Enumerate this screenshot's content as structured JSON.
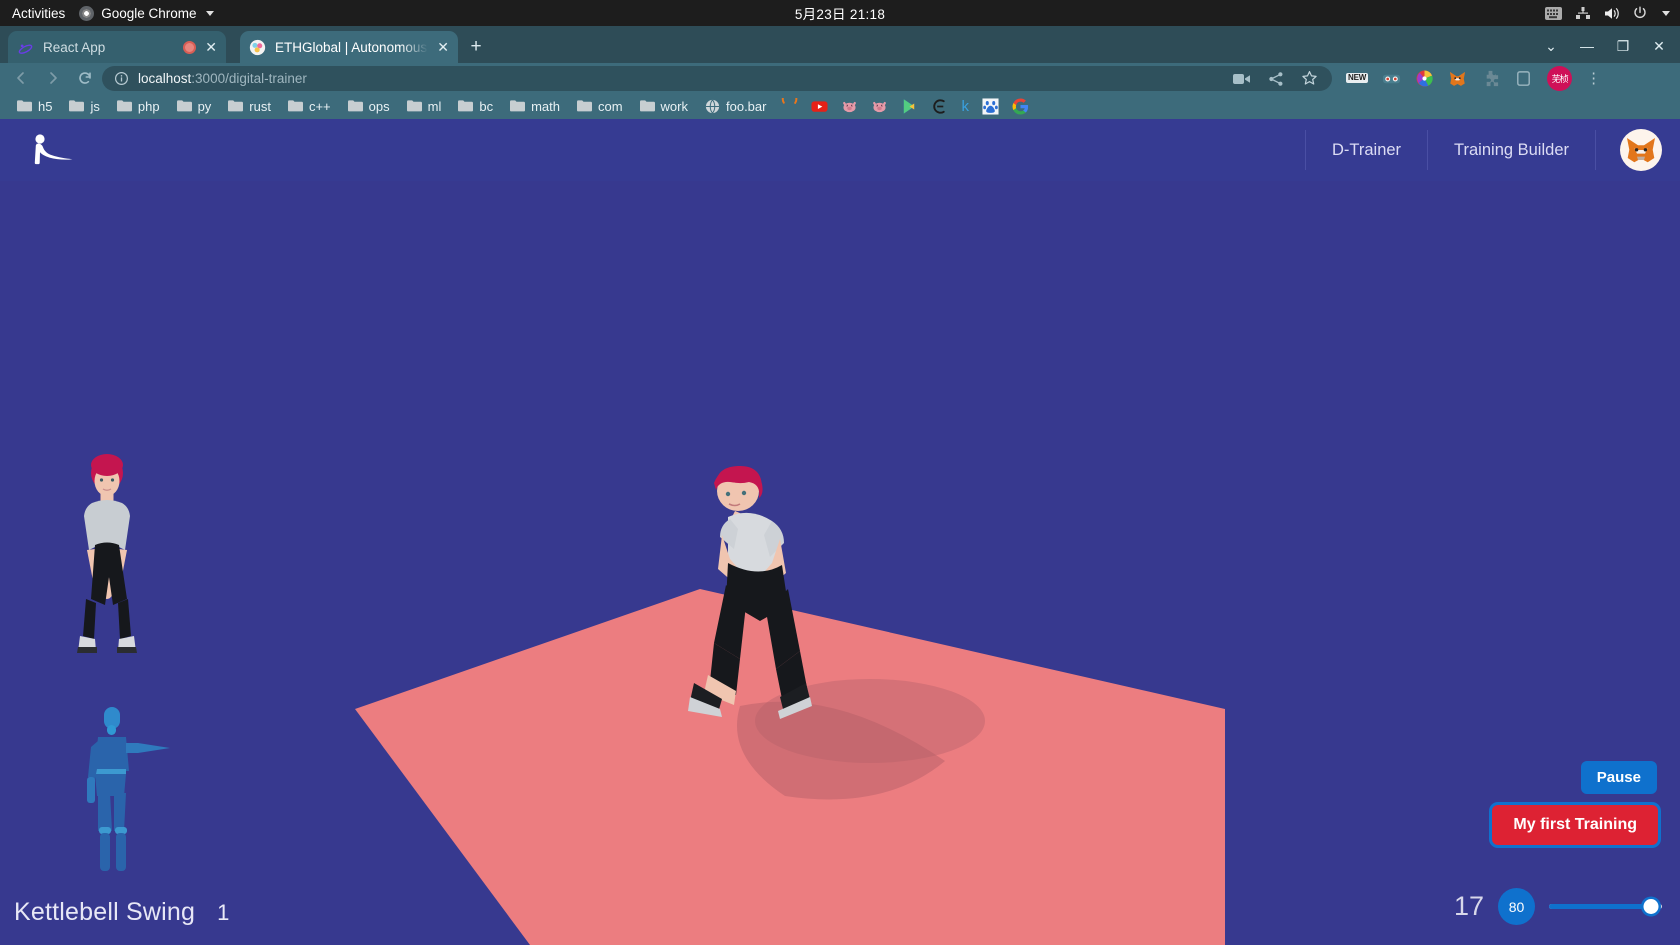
{
  "desktop": {
    "activities_label": "Activities",
    "active_app": "Google Chrome",
    "clock": "5月23日  21:18",
    "tray_icons": [
      "keyboard-icon",
      "network-icon",
      "volume-icon",
      "power-icon",
      "chevron-down-icon"
    ]
  },
  "browser": {
    "tabs": [
      {
        "title": "React App",
        "favicon": "react-icon",
        "recording": true,
        "active": false
      },
      {
        "title": "ETHGlobal | Autonomous",
        "favicon": "ethglobal-icon",
        "recording": false,
        "active": true
      }
    ],
    "new_tab_label": "+",
    "window_controls": [
      "tab-search-chevron",
      "minimize",
      "maximize",
      "close"
    ],
    "nav": {
      "back": "back-icon",
      "forward": "forward-icon",
      "reload": "reload-icon"
    },
    "omnibox": {
      "site_info_icon": "info-circle-icon",
      "url_host": "localhost",
      "url_path": ":3000/digital-trainer",
      "actions": [
        "media-cast-icon",
        "share-icon",
        "bookmark-star-icon"
      ]
    },
    "extensions": [
      {
        "name": "new-badge",
        "label": "NEW"
      },
      {
        "name": "goggles-extension-icon"
      },
      {
        "name": "color-wheel-extension-icon"
      },
      {
        "name": "metamask-fox-icon"
      },
      {
        "name": "puzzle-extensions-icon"
      },
      {
        "name": "sidepanel-icon"
      }
    ],
    "profile": {
      "name": "芜桢",
      "color": "#cf1058"
    },
    "menu_icon": "kebab-menu-icon",
    "bookmarks": [
      {
        "label": "h5",
        "type": "folder"
      },
      {
        "label": "js",
        "type": "folder"
      },
      {
        "label": "php",
        "type": "folder"
      },
      {
        "label": "py",
        "type": "folder"
      },
      {
        "label": "rust",
        "type": "folder"
      },
      {
        "label": "c++",
        "type": "folder"
      },
      {
        "label": "ops",
        "type": "folder"
      },
      {
        "label": "ml",
        "type": "folder"
      },
      {
        "label": "bc",
        "type": "folder"
      },
      {
        "label": "math",
        "type": "folder"
      },
      {
        "label": "com",
        "type": "folder"
      },
      {
        "label": "work",
        "type": "folder"
      },
      {
        "label": "foo.bar",
        "type": "site",
        "icon": "globe-icon"
      }
    ],
    "bookmark_icons": [
      "orange-arc-icon",
      "youtube-icon",
      "pig-face-icon",
      "pig-face-icon-2",
      "play-store-icon",
      "ethereum-icon",
      "k-letter-icon",
      "baidu-paw-icon",
      "google-g-icon"
    ]
  },
  "app": {
    "logo": "yoga-pose-logo",
    "nav_links": [
      "D-Trainer",
      "Training Builder"
    ],
    "wallet_icon": "metamask-fox-avatar",
    "theme": {
      "background": "#37398f",
      "header": "#363b92",
      "floor": "#ec7d80",
      "primary_blue": "#0f71cd",
      "danger_red": "#dd2233"
    },
    "scene": {
      "avatar_preview": "trainee-avatar-thumbnail",
      "pose_mannequin": "pose-tracking-mannequin",
      "main_avatar": "trainer-avatar-3d"
    },
    "exercise": {
      "name": "Kettlebell Swing",
      "rep": "1"
    },
    "controls": {
      "pause_label": "Pause",
      "training_label": "My first Training",
      "counter": "17",
      "level_badge": "80",
      "slider_value": 90
    }
  }
}
